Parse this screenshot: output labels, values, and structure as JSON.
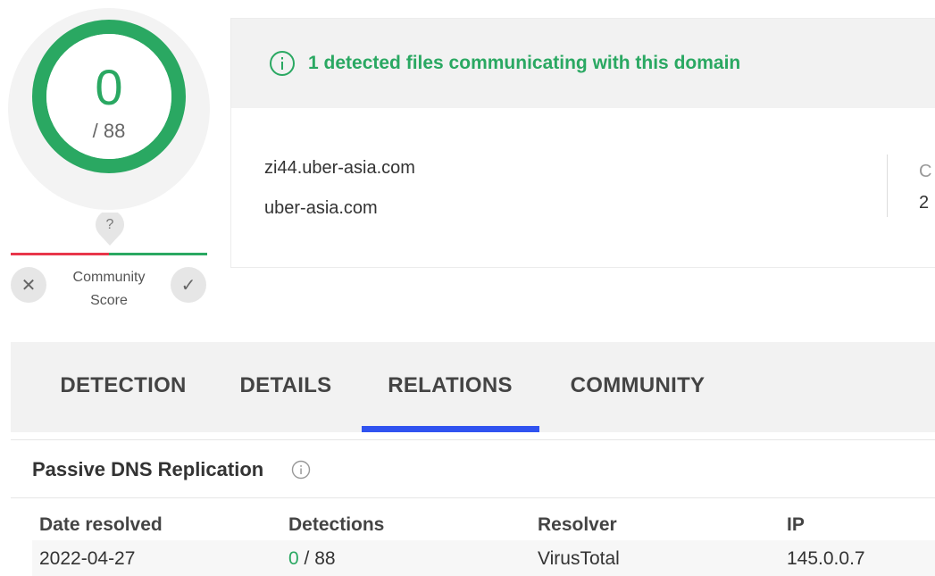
{
  "score": {
    "detected": "0",
    "total": "/ 88",
    "ring_color": "#2aa862"
  },
  "community": {
    "pin": "?",
    "label_line1": "Community",
    "label_line2": "Score",
    "x_glyph": "✕",
    "check_glyph": "✓"
  },
  "info": {
    "banner_text": "1 detected files communicating with this domain",
    "domains": [
      "zi44.uber-asia.com",
      "uber-asia.com"
    ],
    "cut_label": "C",
    "cut_value": "2"
  },
  "tabs": [
    {
      "label": "DETECTION"
    },
    {
      "label": "DETAILS"
    },
    {
      "label": "RELATIONS",
      "active": true
    },
    {
      "label": "COMMUNITY"
    }
  ],
  "section": {
    "title": "Passive DNS Replication"
  },
  "table": {
    "headers": [
      "Date resolved",
      "Detections",
      "Resolver",
      "IP"
    ],
    "rows": [
      {
        "date": "2022-04-27",
        "detections_positive": "0",
        "detections_total": "/ 88",
        "resolver": "VirusTotal",
        "ip": "145.0.0.7"
      }
    ]
  },
  "colors": {
    "accent_green": "#2aa862",
    "accent_red": "#e8364a",
    "tab_underline": "#3053f0"
  }
}
